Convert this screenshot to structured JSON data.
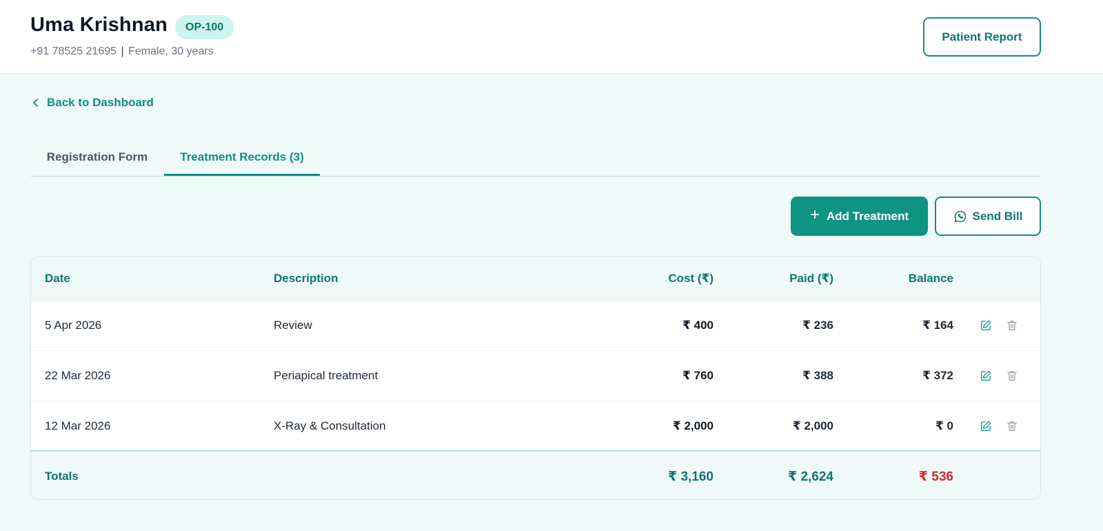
{
  "patient": {
    "name": "Uma Krishnan",
    "op_id": "OP-100",
    "phone": "+91 78525 21695",
    "separator": "|",
    "details": "Female, 30 years"
  },
  "header": {
    "report_label": "Patient Report"
  },
  "nav": {
    "back_label": "Back to Dashboard"
  },
  "tabs": [
    {
      "label": "Registration Form",
      "active": false
    },
    {
      "label": "Treatment Records (3)",
      "active": true
    }
  ],
  "toolbar": {
    "add_label": "Add Treatment",
    "send_label": "Send Bill"
  },
  "table": {
    "columns": [
      "Date",
      "Description",
      "Cost (₹)",
      "Paid (₹)",
      "Balance"
    ],
    "rows": [
      {
        "date": "5 Apr 2026",
        "description": "Review",
        "cost": "₹ 400",
        "paid": "₹ 236",
        "balance": "₹ 164"
      },
      {
        "date": "22 Mar 2026",
        "description": "Periapical treatment",
        "cost": "₹ 760",
        "paid": "₹ 388",
        "balance": "₹ 372"
      },
      {
        "date": "12 Mar 2026",
        "description": "X-Ray & Consultation",
        "cost": "₹ 2,000",
        "paid": "₹ 2,000",
        "balance": "₹ 0"
      }
    ],
    "totals": {
      "label": "Totals",
      "cost": "₹ 3,160",
      "paid": "₹ 2,624",
      "balance": "₹ 536"
    }
  },
  "icons": {
    "back": "chevron-left-icon",
    "add": "plus-icon",
    "send": "whatsapp-icon",
    "edit": "edit-icon",
    "delete": "trash-icon"
  },
  "colors": {
    "accent": "#0f9484",
    "background": "#effaf8",
    "paid": "#1b8a3c",
    "balance_due": "#dc2626",
    "balance_clear": "#16a34a"
  }
}
